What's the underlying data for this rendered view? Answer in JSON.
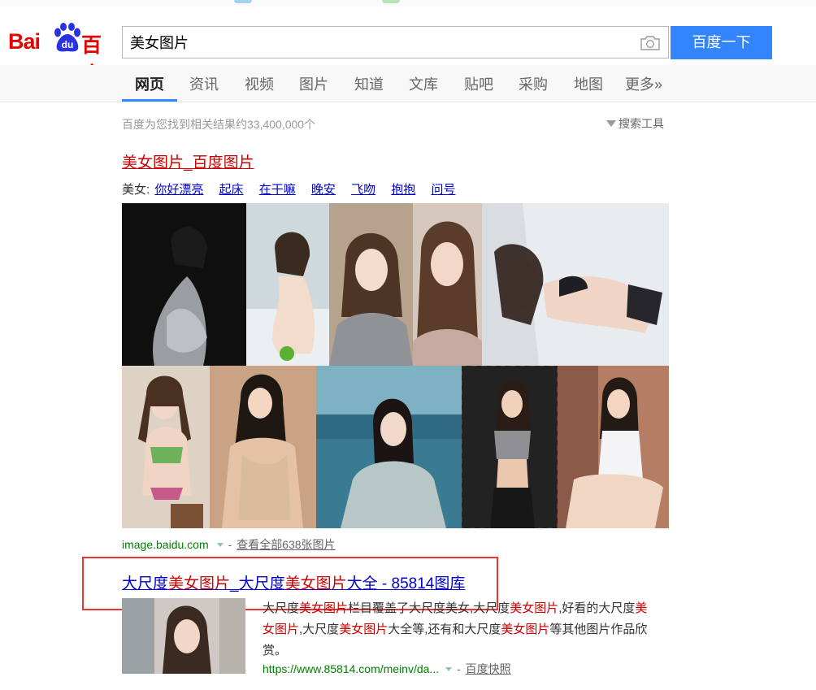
{
  "logo": {
    "text_latin": "Bai",
    "text_du": "du",
    "text_cn": "百度"
  },
  "search": {
    "query": "美女图片",
    "button_label": "百度一下",
    "camera_icon": "camera-icon"
  },
  "tabs": [
    {
      "label": "网页",
      "active": true
    },
    {
      "label": "资讯"
    },
    {
      "label": "视频"
    },
    {
      "label": "图片"
    },
    {
      "label": "知道"
    },
    {
      "label": "文库"
    },
    {
      "label": "贴吧"
    },
    {
      "label": "采购"
    },
    {
      "label": "地图"
    },
    {
      "label": "更多»"
    }
  ],
  "stats": {
    "text": "百度为您找到相关结果约33,400,000个",
    "tools_label": "搜索工具"
  },
  "result1": {
    "title": "美女图片_百度图片",
    "tags_label": "美女:",
    "tags": [
      "你好漂亮",
      "起床",
      "在干嘛",
      "晚安",
      "飞吻",
      "抱抱",
      "问号"
    ],
    "url": "image.baidu.com",
    "dash": "-",
    "more_label": "查看全部638张图片"
  },
  "result2": {
    "title_parts": [
      "大尺度",
      "美女图片",
      "_大尺度",
      "美女图片",
      "大全 - 85814图库"
    ],
    "desc_parts": [
      "大尺度",
      "美女图片",
      "栏目覆盖了大尺度美女,大尺度",
      "美女图片",
      ",好看的大尺度",
      "美女图片",
      ",大尺度",
      "美女图片",
      "大全等,还有和大尺度",
      "美女图片",
      "等其他图片作品欣赏。"
    ],
    "url": "https://www.85814.com/meinv/da...",
    "dash": "-",
    "snapshot_label": "百度快照"
  },
  "colors": {
    "brand_red": "#e10602",
    "accent_blue": "#3385ff",
    "link_blue": "#0000cc",
    "highlight_red": "#cc0000",
    "url_green": "#008000",
    "annotation_red": "#ee3333"
  }
}
